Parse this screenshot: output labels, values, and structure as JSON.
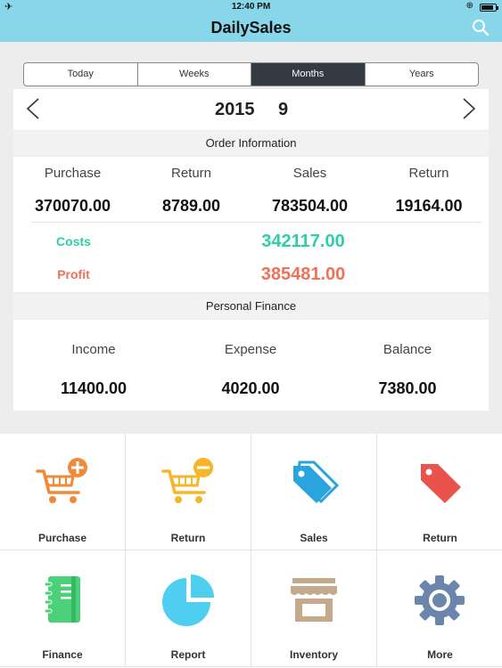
{
  "status": {
    "time": "12:40 PM",
    "battery_level": 0.85
  },
  "nav": {
    "title": "DailySales"
  },
  "period_tabs": [
    "Today",
    "Weeks",
    "Months",
    "Years"
  ],
  "active_tab": "Months",
  "date": {
    "year": "2015",
    "month": "9"
  },
  "order": {
    "header": "Order Information",
    "labels": [
      "Purchase",
      "Return",
      "Sales",
      "Return"
    ],
    "values": [
      "370070.00",
      "8789.00",
      "783504.00",
      "19164.00"
    ],
    "costs_label": "Costs",
    "costs_value": "342117.00",
    "profit_label": "Profit",
    "profit_value": "385481.00"
  },
  "finance": {
    "header": "Personal Finance",
    "labels": [
      "Income",
      "Expense",
      "Balance"
    ],
    "values": [
      "11400.00",
      "4020.00",
      "7380.00"
    ]
  },
  "menu": [
    {
      "label": "Purchase",
      "icon": "cart-add-icon"
    },
    {
      "label": "Return",
      "icon": "cart-remove-icon"
    },
    {
      "label": "Sales",
      "icon": "tag-blue-icon"
    },
    {
      "label": "Return",
      "icon": "tag-red-icon"
    },
    {
      "label": "Finance",
      "icon": "notebook-icon"
    },
    {
      "label": "Report",
      "icon": "pie-chart-icon"
    },
    {
      "label": "Inventory",
      "icon": "storefront-icon"
    },
    {
      "label": "More",
      "icon": "gear-icon"
    }
  ],
  "colors": {
    "bar": "#87d6ea",
    "active_tab": "#333a44",
    "costs": "#2ecfa6",
    "profit": "#ee7158",
    "orange": "#f08a3b",
    "yellow": "#f7b52a",
    "blue": "#2aa4dd",
    "red": "#e9534c",
    "green": "#4cd07a",
    "cyan": "#4fcff0",
    "tan": "#c4a98c",
    "gear": "#6b86ad"
  }
}
